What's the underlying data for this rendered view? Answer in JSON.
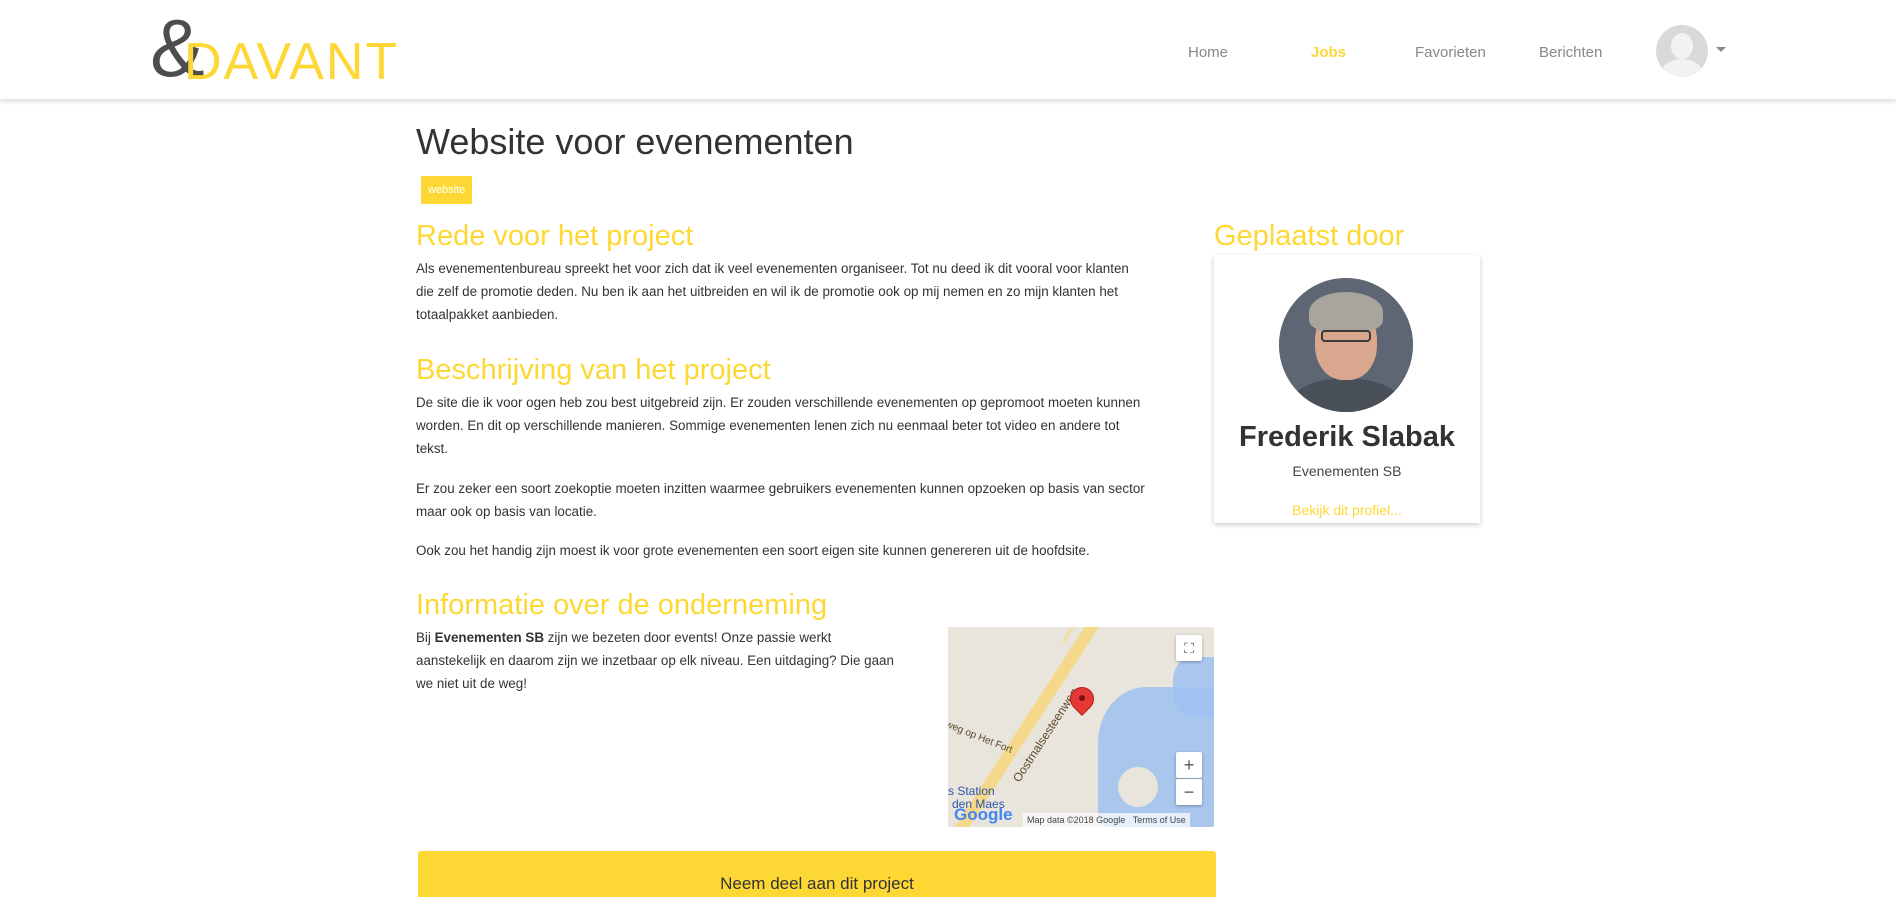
{
  "header": {
    "logo_symbol": "&",
    "logo_text": "DAVANT",
    "nav": [
      "Home",
      "Jobs",
      "Favorieten",
      "Berichten"
    ],
    "active_nav": "Jobs"
  },
  "project": {
    "title": "Website voor evenementen",
    "tag": "website"
  },
  "sections": {
    "reason": {
      "heading": "Rede voor het project",
      "lines": [
        "Als evenementenbureau spreekt het voor zich dat ik veel evenementen organiseer. Tot nu deed ik dit vooral voor klanten",
        "die zelf de promotie deden. Nu ben ik aan het uitbreiden en wil ik de promotie ook op mij nemen en zo mijn klanten het",
        "totaalpakket aanbieden."
      ]
    },
    "description": {
      "heading": "Beschrijving van het project",
      "para1": [
        "De site die ik voor ogen heb zou best uitgebreid zijn.  Er zouden verschillende evenementen op gepromoot moeten kunnen",
        "worden. En dit op verschillende manieren. Sommige evenementen lenen zich nu eenmaal beter tot video en andere tot",
        "tekst."
      ],
      "para2": [
        "Er zou zeker een soort zoekoptie moeten inzitten waarmee gebruikers evenementen kunnen opzoeken op basis van sector",
        "maar ook op basis van locatie."
      ],
      "para3": "Ook zou het handig zijn moest ik voor grote evenementen een soort eigen site kunnen genereren uit de hoofdsite."
    },
    "company": {
      "heading": "Informatie over de onderneming",
      "prefix": "Bij ",
      "company_name": "Evenementen SB",
      "line1_rest": " zijn we bezeten door events! Onze passie werkt",
      "line2": "aanstekelijk en daarom zijn we inzetbaar op elk niveau. Een uitdaging? Die gaan",
      "line3": "we niet uit de weg!"
    }
  },
  "map": {
    "road_label": "Oostmalsesteenweg",
    "road_label2": "weg op Het Fort",
    "station_label": "s Station",
    "station_label2": "den Maes",
    "google": "Google",
    "map_data": "Map data ©2018 Google",
    "terms": "Terms of Use",
    "zoom_in": "+",
    "zoom_out": "−",
    "fullscreen": "⛶"
  },
  "actions": {
    "join_label": "Neem deel aan dit project"
  },
  "poster": {
    "heading": "Geplaatst door",
    "name": "Frederik Slabak",
    "company": "Evenementen SB",
    "profile_link": "Bekijk dit profiel..."
  },
  "colors": {
    "accent": "#fdd835",
    "text": "#333333",
    "nav_inactive": "#888888"
  }
}
